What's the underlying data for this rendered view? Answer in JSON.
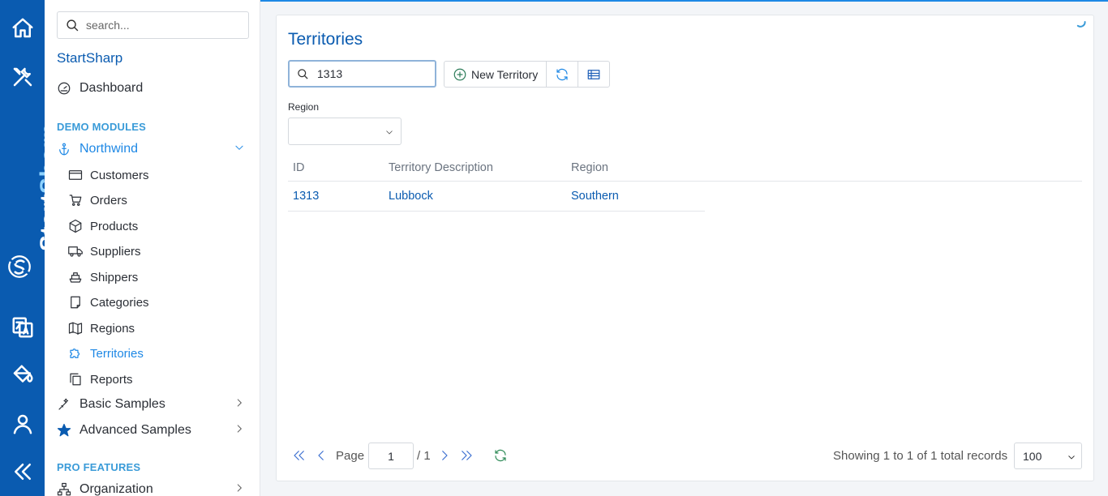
{
  "rail": {
    "brand_start": "Start",
    "brand_sharp": "Sharp"
  },
  "sidebar": {
    "search_placeholder": "search...",
    "app_title": "StartSharp",
    "dashboard": "Dashboard",
    "section_demo": "DEMO MODULES",
    "northwind": "Northwind",
    "items": [
      {
        "label": "Customers"
      },
      {
        "label": "Orders"
      },
      {
        "label": "Products"
      },
      {
        "label": "Suppliers"
      },
      {
        "label": "Shippers"
      },
      {
        "label": "Categories"
      },
      {
        "label": "Regions"
      },
      {
        "label": "Territories"
      },
      {
        "label": "Reports"
      }
    ],
    "basic_samples": "Basic Samples",
    "advanced_samples": "Advanced Samples",
    "section_pro": "PRO FEATURES",
    "organization": "Organization"
  },
  "main": {
    "title": "Territories",
    "quick_search_value": "1313",
    "new_button": "New Territory",
    "filter_label": "Region",
    "filter_value": "",
    "columns": [
      "ID",
      "Territory Description",
      "Region"
    ],
    "rows": [
      {
        "id": "1313",
        "description": "Lubbock",
        "region": "Southern"
      }
    ]
  },
  "pager": {
    "page_label": "Page",
    "current_page": "1",
    "total_pages": "/ 1",
    "status": "Showing 1 to 1 of 1 total records",
    "page_size": "100"
  },
  "colors": {
    "rail": "#0a5bb0",
    "accent": "#1e88e5",
    "link": "#0a5bb0",
    "section": "#3a9bd8"
  }
}
